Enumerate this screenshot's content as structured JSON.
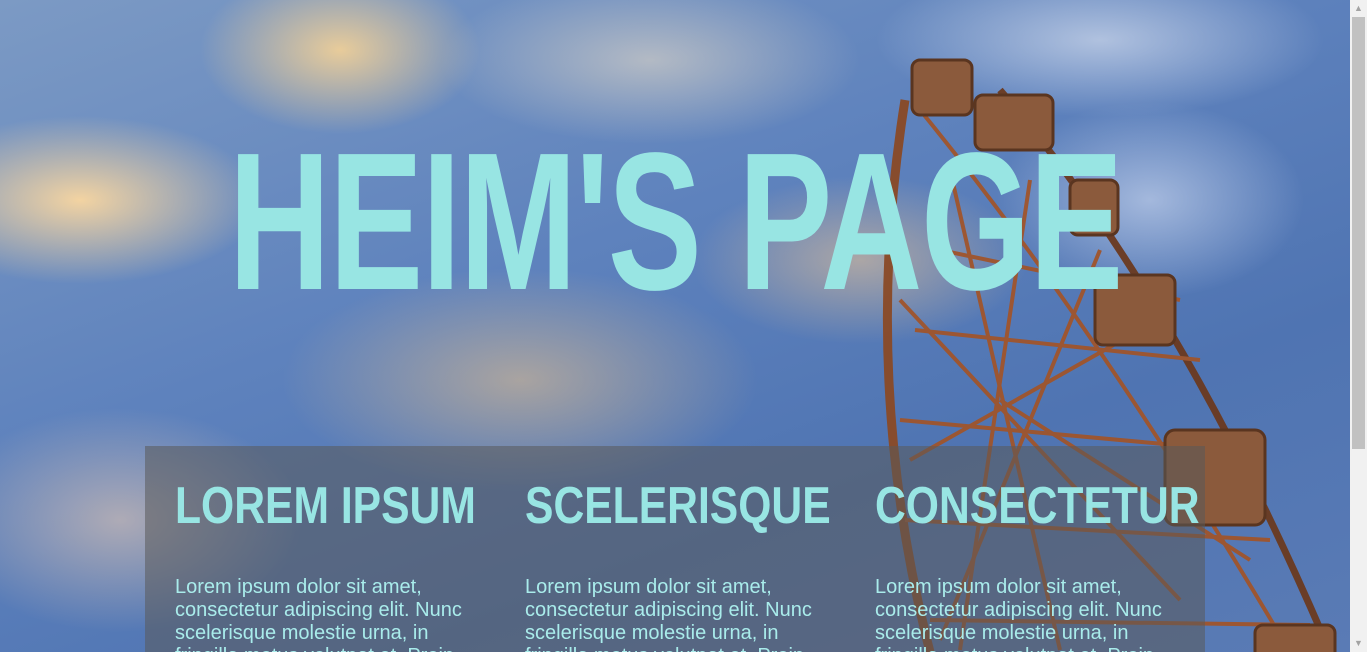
{
  "hero": {
    "title": "HEIM'S PAGE"
  },
  "columns": [
    {
      "heading": "LOREM IPSUM",
      "text": "Lorem ipsum dolor sit amet, consectetur adipiscing elit. Nunc scelerisque molestie urna, in fringilla metus volutpat et. Proin"
    },
    {
      "heading": "SCELERISQUE",
      "text": "Lorem ipsum dolor sit amet, consectetur adipiscing elit. Nunc scelerisque molestie urna, in fringilla metus volutpat et. Proin"
    },
    {
      "heading": "CONSECTETUR",
      "text": "Lorem ipsum dolor sit amet, consectetur adipiscing elit. Nunc scelerisque molestie urna, in fringilla metus volutpat et. Proin"
    }
  ],
  "colors": {
    "accent": "#98e5e3",
    "panel": "#5a5a5a"
  },
  "scrollbar": {
    "up_icon": "▲",
    "down_icon": "▼"
  }
}
